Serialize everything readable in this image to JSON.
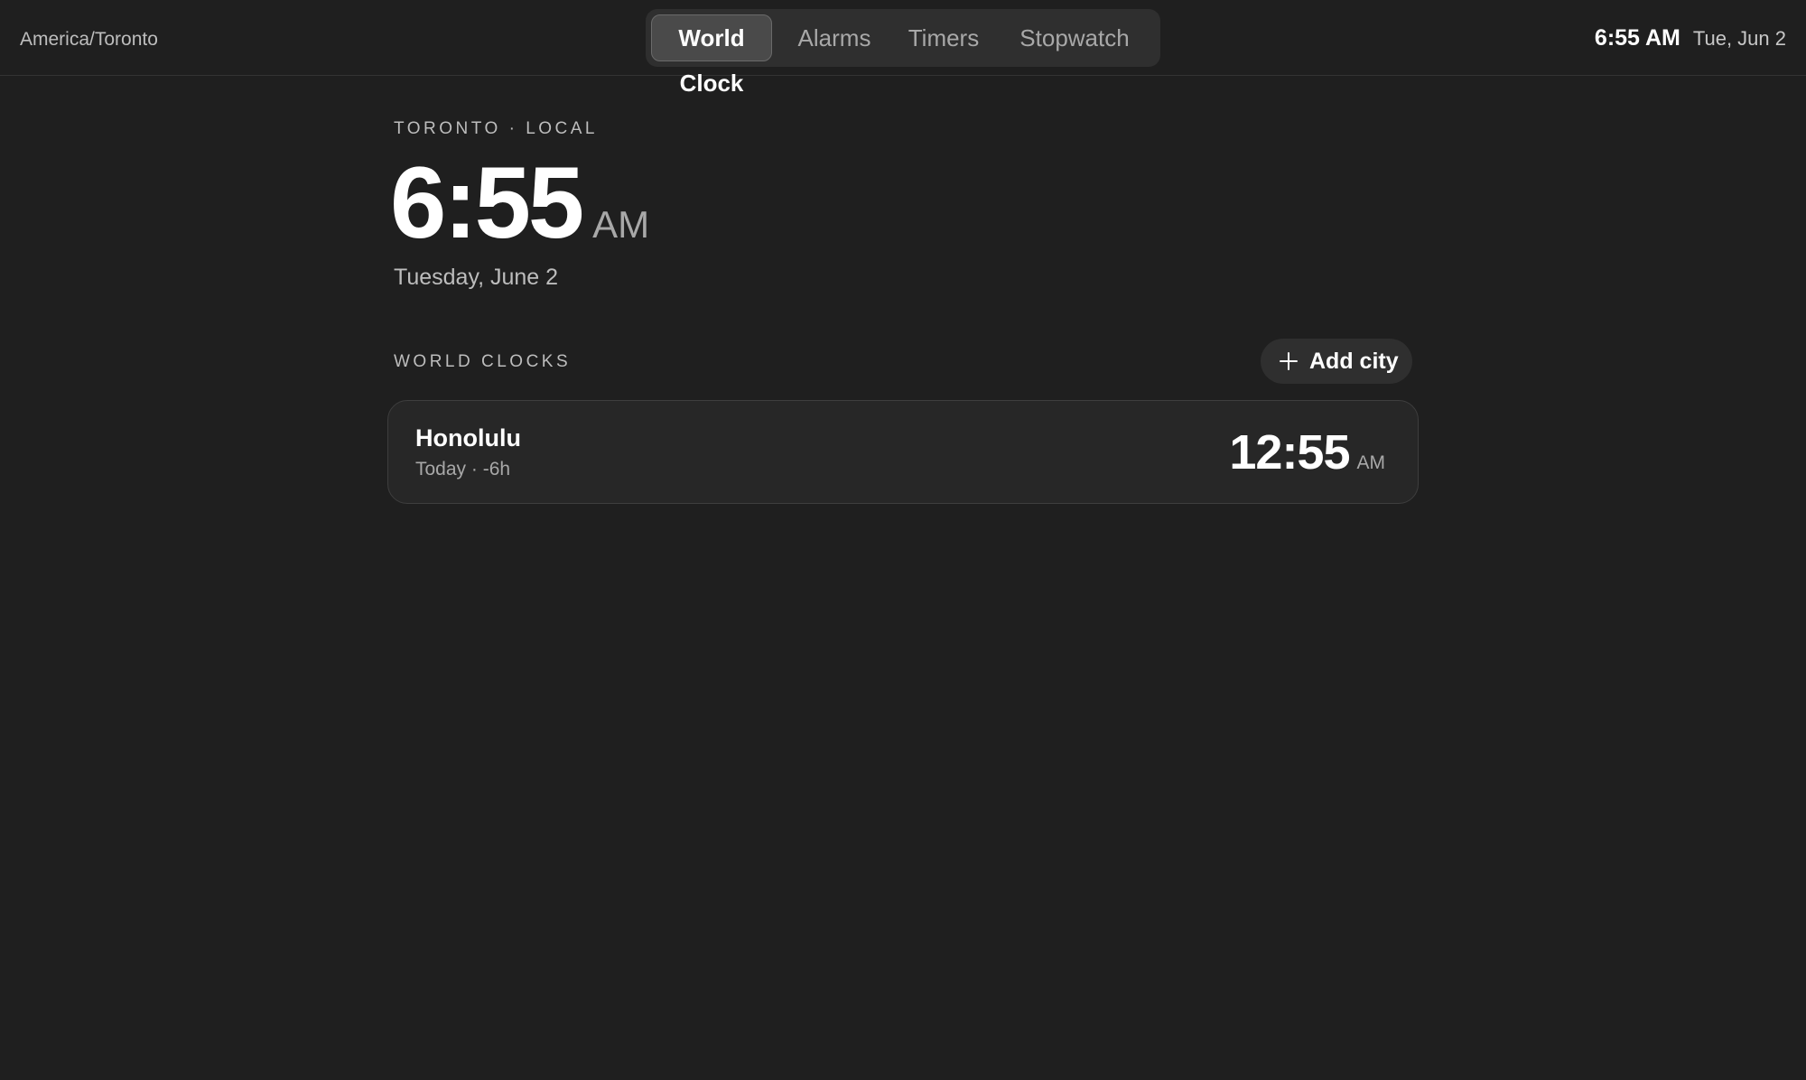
{
  "header": {
    "timezone": "America/Toronto",
    "tabs": [
      {
        "label": "World Clock",
        "active": true
      },
      {
        "label": "Alarms",
        "active": false
      },
      {
        "label": "Timers",
        "active": false
      },
      {
        "label": "Stopwatch",
        "active": false
      }
    ],
    "current_time": "6:55 AM",
    "current_date": "Tue, Jun 2"
  },
  "local": {
    "label": "TORONTO · LOCAL",
    "time": "6:55",
    "ampm": "AM",
    "date": "Tuesday, June 2"
  },
  "world_clocks": {
    "header": "WORLD CLOCKS",
    "add_city_label": "Add city",
    "add_city_icon": "plus-icon",
    "cities": [
      {
        "name": "Honolulu",
        "subtitle": "Today · -6h",
        "time": "12:55",
        "ampm": "AM"
      }
    ]
  },
  "colors": {
    "background": "#1f1f1f",
    "card": "#272727",
    "tab_active": "#4a4a4a",
    "text_primary": "#ffffff",
    "text_secondary": "#a8a8a8"
  }
}
